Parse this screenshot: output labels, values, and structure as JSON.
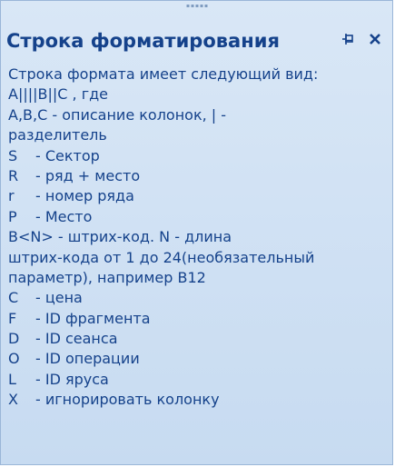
{
  "panel": {
    "title": "Строка форматирования"
  },
  "description": {
    "lines": [
      "Строка формата имеет следующий вид:",
      "A||||B||C , где",
      "A,B,C - описание колонок, | -",
      "разделитель"
    ]
  },
  "codes": [
    {
      "code": "S",
      "desc": "- Сектор"
    },
    {
      "code": "R",
      "desc": "- ряд + место"
    },
    {
      "code": "r",
      "desc": "- номер ряда"
    },
    {
      "code": "P",
      "desc": "- Место"
    }
  ],
  "barcode": {
    "lines": [
      "B<N> - штрих-код. N - длина",
      "штрих-кода от 1 до 24(необязательный",
      "параметр), например B12"
    ]
  },
  "codes2": [
    {
      "code": "C",
      "desc": "- цена"
    },
    {
      "code": "F",
      "desc": "- ID фрагмента"
    },
    {
      "code": "D",
      "desc": "- ID сеанса"
    },
    {
      "code": "O",
      "desc": "- ID операции"
    },
    {
      "code": "L",
      "desc": "- ID яруса"
    },
    {
      "code": "X",
      "desc": "- игнорировать колонку"
    }
  ]
}
